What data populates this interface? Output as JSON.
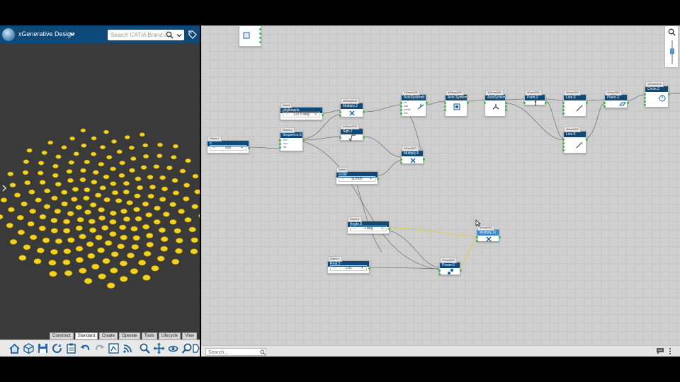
{
  "app": {
    "title": "xGenerative Design"
  },
  "search": {
    "placeholder": "Search CATIA Brand as"
  },
  "bottom_search": {
    "placeholder": "Search..."
  },
  "tabs": [
    {
      "label": "Construct",
      "active": false
    },
    {
      "label": "Standard",
      "active": true
    },
    {
      "label": "Create",
      "active": false
    },
    {
      "label": "Operate",
      "active": false
    },
    {
      "label": "Tools",
      "active": false
    },
    {
      "label": "Lifecycle",
      "active": false
    },
    {
      "label": "View",
      "active": false
    }
  ],
  "toolbar_icons": [
    "home-icon",
    "cube-icon",
    "save-icon",
    "refresh-icon",
    "clipboard-icon",
    "undo-icon",
    "redo-icon",
    "fit-icon",
    "rss-icon",
    "zoom-icon",
    "pan-icon",
    "rotate-icon",
    "magnify-icon",
    "tag-small-icon"
  ],
  "colors": {
    "brand": "#0d4a7a",
    "dot": "#f5d21a",
    "port": "#3cb84a",
    "wire": "#7a7a7a",
    "wire_selected": "#d8cf5a"
  },
  "nodes": {
    "n": {
      "tag": "Direct.1",
      "title": "n",
      "value": "200"
    },
    "phyllo": {
      "tag": "Direct",
      "title": "phyllotaxis",
      "value": "137.5 deg"
    },
    "sequence": {
      "tag": "Direct.1",
      "title": "Sequence.5",
      "ports": [
        "Ref",
        "Incr",
        "Nb"
      ]
    },
    "multiply3": {
      "tag": "450ms/200",
      "title": "Multiply.3"
    },
    "sqrt2": {
      "tag": "420ms/200",
      "title": "Sqrt.2"
    },
    "scale": {
      "tag": "Direct",
      "title": "scale",
      "value": "50 mm"
    },
    "multiply4": {
      "tag": "10ms/200",
      "title": "Multiply.4"
    },
    "axis1": {
      "tag": "120ms/200",
      "title": "AxisSystemB",
      "ports": [
        "ref",
        "size",
        "points",
        "info"
      ]
    },
    "axis2": {
      "tag": "490ms/200",
      "title": "Axis System"
    },
    "axis3": {
      "tag": "110ms/200",
      "title": "AxisSystem"
    },
    "point3": {
      "tag": "30ms/200",
      "title": "Point.3"
    },
    "line6": {
      "tag": "40ms/200",
      "title": "Line.6"
    },
    "line5": {
      "tag": "40ms/200",
      "title": "Line.5"
    },
    "plane3": {
      "tag": "40ms/200",
      "title": "Plane.3"
    },
    "circle2": {
      "tag": "120ms/200",
      "title": "Circle.2"
    },
    "angle8": {
      "tag": "Direct.1",
      "title": "Angle.8",
      "value": "1 deg"
    },
    "multiply12": {
      "tag": "10ms/200",
      "title": "Multiply.12"
    },
    "real5": {
      "tag": "Direct.1",
      "title": "Real.5",
      "value": "1.01"
    },
    "power5": {
      "tag": "10ms/200",
      "title": "Power.5"
    }
  }
}
